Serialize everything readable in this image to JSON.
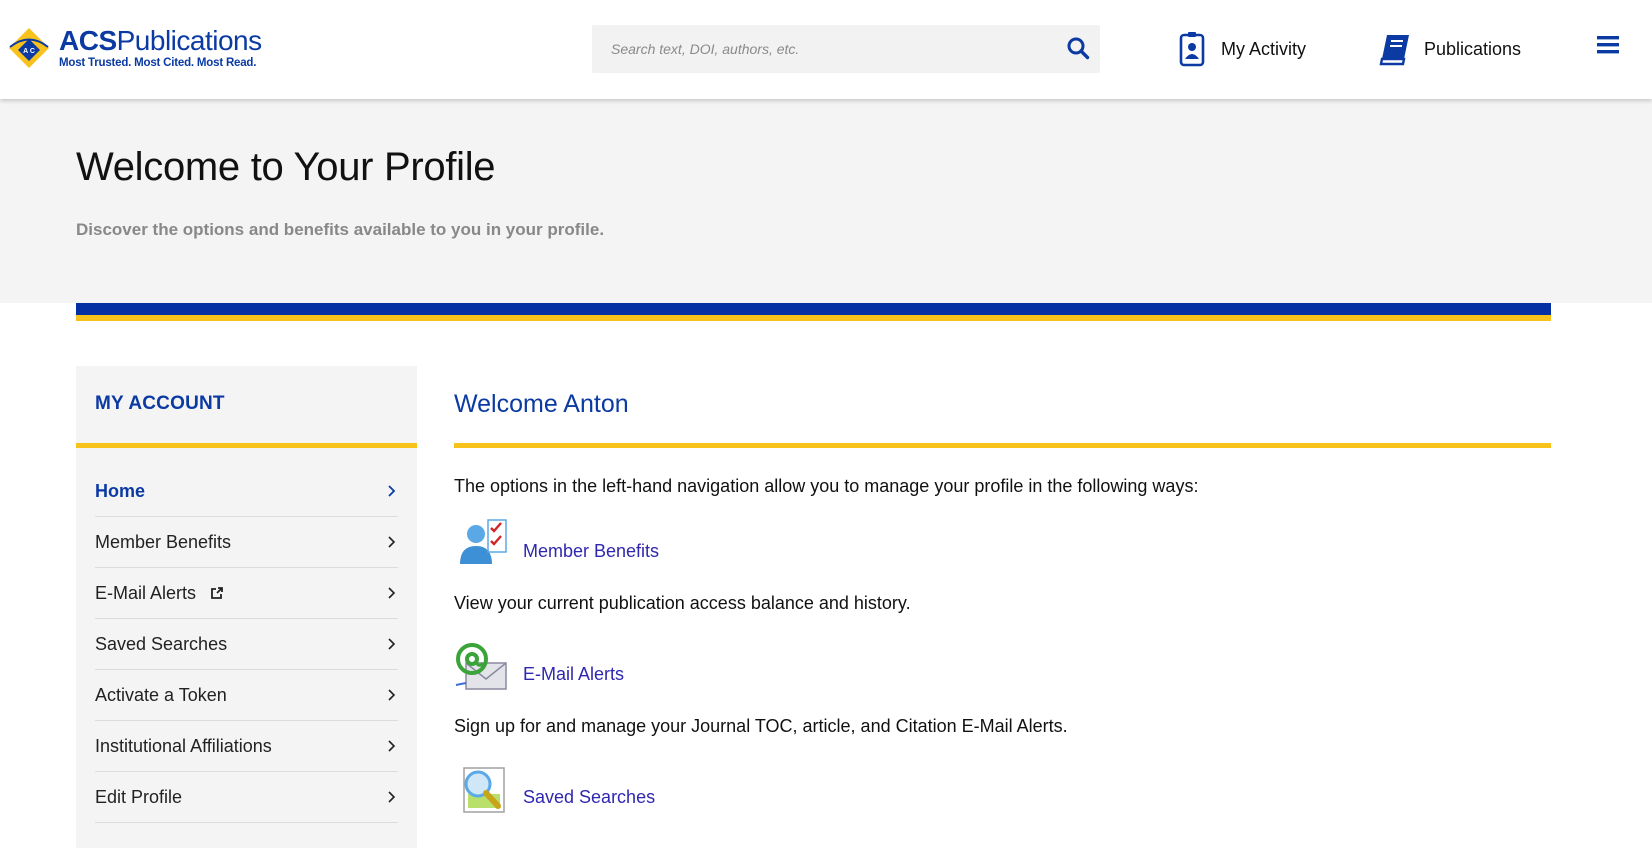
{
  "header": {
    "logo": {
      "brand_bold": "ACS",
      "brand_rest": "Publications",
      "tagline": "Most Trusted. Most Cited. Most Read."
    },
    "search": {
      "placeholder": "Search text, DOI, authors, etc.",
      "value": ""
    },
    "nav": [
      {
        "label": "My Activity",
        "icon": "id-badge-icon"
      },
      {
        "label": "Publications",
        "icon": "book-icon"
      }
    ],
    "menu_icon": "hamburger-menu-icon"
  },
  "hero": {
    "title": "Welcome to Your Profile",
    "subtitle": "Discover the options and benefits available to you in your profile."
  },
  "sidebar": {
    "title": "MY ACCOUNT",
    "items": [
      {
        "label": "Home",
        "active": true
      },
      {
        "label": "Member Benefits"
      },
      {
        "label": "E-Mail Alerts",
        "external": true
      },
      {
        "label": "Saved Searches"
      },
      {
        "label": "Activate a Token"
      },
      {
        "label": "Institutional Affiliations"
      },
      {
        "label": "Edit Profile"
      }
    ]
  },
  "main": {
    "greeting": "Welcome Anton",
    "intro": "The options in the left-hand navigation allow you to manage your profile in the following ways:",
    "features": [
      {
        "link": "Member Benefits",
        "icon": "member-checklist-icon",
        "description": "View your current publication access balance and history."
      },
      {
        "link": "E-Mail Alerts",
        "icon": "email-at-icon",
        "description": "Sign up for and manage your Journal TOC, article, and Citation E-Mail Alerts."
      },
      {
        "link": "Saved Searches",
        "icon": "saved-search-magnifier-icon"
      }
    ]
  },
  "colors": {
    "brand_blue": "#0530a4",
    "accent_yellow": "#f7c21b",
    "link_purple": "#2f27b0",
    "hero_bg": "#f4f4f4"
  }
}
